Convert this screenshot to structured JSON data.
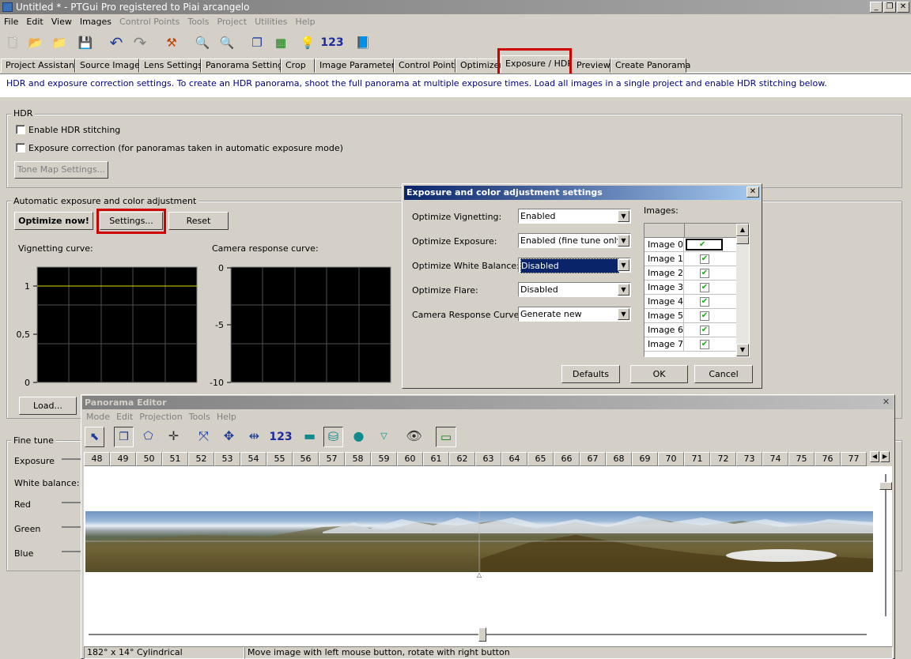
{
  "window": {
    "title": "Untitled * - PTGui Pro registered to Piai arcangelo"
  },
  "menu": [
    "File",
    "Edit",
    "View",
    "Images",
    "Control Points",
    "Tools",
    "Project",
    "Utilities",
    "Help"
  ],
  "toolbar": {
    "number_label": "123"
  },
  "tabs": [
    "Project Assistant",
    "Source Images",
    "Lens Settings",
    "Panorama Settings",
    "Crop",
    "Image Parameters",
    "Control Points",
    "Optimizer",
    "Exposure / HDR",
    "Preview",
    "Create Panorama"
  ],
  "info": "HDR and exposure correction settings. To create an HDR panorama, shoot the full panorama at multiple exposure times. Load all images in a single project and enable HDR stitching below.",
  "hdr": {
    "group_label": "HDR",
    "enable_label": "Enable HDR stitching",
    "exposure_label": "Exposure correction (for panoramas taken in automatic exposure mode)",
    "tonemap_label": "Tone Map Settings..."
  },
  "auto": {
    "group_label": "Automatic exposure and color adjustment",
    "optimize_label": "Optimize now!",
    "settings_label": "Settings...",
    "reset_label": "Reset",
    "vignetting_label": "Vignetting curve:",
    "camera_label": "Camera response curve:",
    "vig_ticks": [
      "1",
      "0,5",
      "0"
    ],
    "cam_ticks": [
      "0",
      "-5",
      "-10"
    ],
    "load_label": "Load..."
  },
  "finetune": {
    "group_label": "Fine tune",
    "exposure_label": "Exposure",
    "wb_label": "White balance:",
    "red_label": "Red",
    "green_label": "Green",
    "blue_label": "Blue"
  },
  "dialog": {
    "title": "Exposure and color adjustment settings",
    "rows": [
      {
        "label": "Optimize Vignetting:",
        "value": "Enabled"
      },
      {
        "label": "Optimize Exposure:",
        "value": "Enabled (fine tune only)"
      },
      {
        "label": "Optimize White Balance:",
        "value": "Disabled"
      },
      {
        "label": "Optimize Flare:",
        "value": "Disabled"
      },
      {
        "label": "Camera Response Curve:",
        "value": "Generate new"
      }
    ],
    "images_label": "Images:",
    "images": [
      "Image 0",
      "Image 1",
      "Image 2",
      "Image 3",
      "Image 4",
      "Image 5",
      "Image 6",
      "Image 7"
    ],
    "defaults_label": "Defaults",
    "ok_label": "OK",
    "cancel_label": "Cancel"
  },
  "panorama_editor": {
    "title": "Panorama Editor",
    "menu": [
      "Mode",
      "Edit",
      "Projection",
      "Tools",
      "Help"
    ],
    "number_label": "123",
    "ruler": [
      "48",
      "49",
      "50",
      "51",
      "52",
      "53",
      "54",
      "55",
      "56",
      "57",
      "58",
      "59",
      "60",
      "61",
      "62",
      "63",
      "64",
      "65",
      "66",
      "67",
      "68",
      "69",
      "70",
      "71",
      "72",
      "73",
      "74",
      "75",
      "76",
      "77"
    ],
    "status_left": "182° x 14° Cylindrical",
    "status_right": "Move image with left mouse button, rotate with right button"
  }
}
